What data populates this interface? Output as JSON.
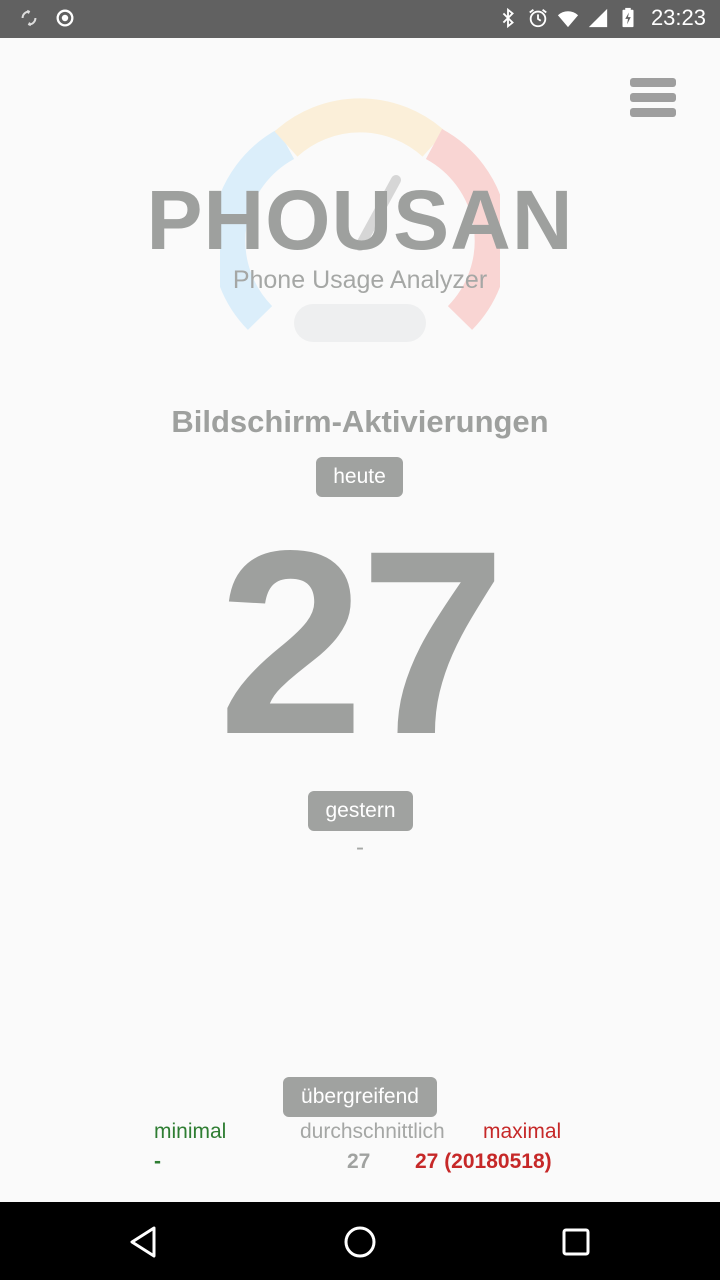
{
  "status_bar": {
    "time": "23:23",
    "icons": [
      "sync-icon",
      "record-icon",
      "bluetooth-icon",
      "alarm-icon",
      "wifi-icon",
      "signal-icon",
      "battery-charging-icon"
    ]
  },
  "app": {
    "title": "PHOUSAN",
    "subtitle": "Phone Usage Analyzer",
    "menu_icon": "hamburger-menu-icon"
  },
  "main": {
    "section_title": "Bildschirm-Aktivierungen",
    "today_label": "heute",
    "today_value": "27",
    "yesterday_label": "gestern",
    "yesterday_value": "-"
  },
  "overall": {
    "label": "übergreifend",
    "min_label": "minimal",
    "min_value": "-",
    "avg_label": "durchschnittlich",
    "avg_value": "27",
    "max_label": "maximal",
    "max_value": "27 (20180518)"
  },
  "colors": {
    "min": "#2e7d32",
    "max": "#c62828",
    "muted": "#9ea09e",
    "statusbar": "#616161"
  }
}
